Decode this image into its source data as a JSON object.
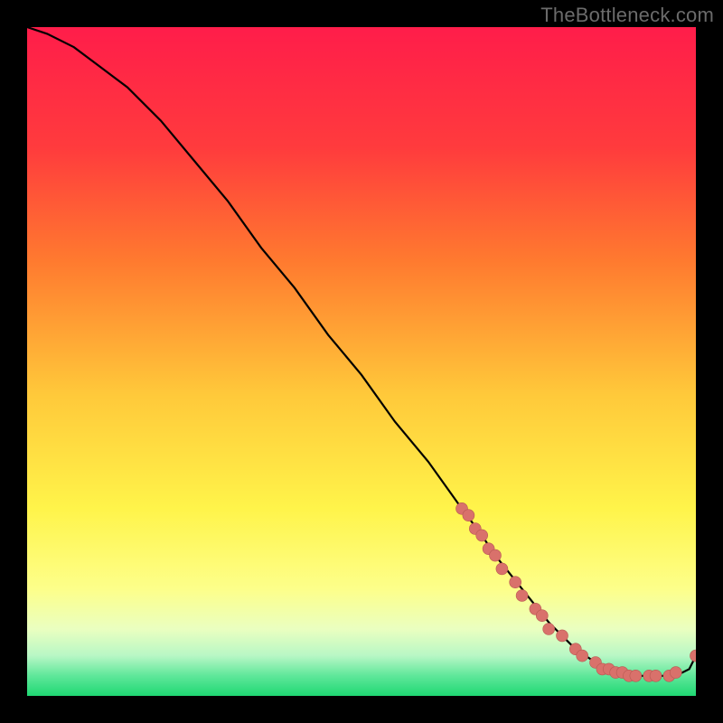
{
  "watermark": "TheBottleneck.com",
  "colors": {
    "gradient_top": "#ff1d4a",
    "gradient_mid1": "#ff6a2f",
    "gradient_mid2": "#ffd23a",
    "gradient_mid3": "#fff44a",
    "gradient_light": "#f7ffb3",
    "gradient_green1": "#a8f7c0",
    "gradient_green2": "#28e07a",
    "curve": "#000000",
    "point_fill": "#d9716b",
    "point_stroke": "#b85a53",
    "background": "#000000"
  },
  "chart_data": {
    "type": "line",
    "title": "",
    "xlabel": "",
    "ylabel": "",
    "xlim": [
      0,
      100
    ],
    "ylim": [
      0,
      100
    ],
    "grid": false,
    "legend": false,
    "series": [
      {
        "name": "bottleneck-curve",
        "x": [
          0,
          3,
          7,
          11,
          15,
          20,
          25,
          30,
          35,
          40,
          45,
          50,
          55,
          60,
          65,
          68,
          70,
          74,
          78,
          82,
          85,
          88,
          90,
          92,
          95,
          97,
          99,
          100
        ],
        "y": [
          100,
          99,
          97,
          94,
          91,
          86,
          80,
          74,
          67,
          61,
          54,
          48,
          41,
          35,
          28,
          24,
          21,
          16,
          11,
          7,
          5,
          4,
          3,
          3,
          3,
          3,
          4,
          6
        ]
      }
    ],
    "highlight_points": {
      "name": "highlight-dots",
      "color": "#d9716b",
      "points": [
        {
          "x": 65,
          "y": 28
        },
        {
          "x": 66,
          "y": 27
        },
        {
          "x": 67,
          "y": 25
        },
        {
          "x": 68,
          "y": 24
        },
        {
          "x": 69,
          "y": 22
        },
        {
          "x": 70,
          "y": 21
        },
        {
          "x": 71,
          "y": 19
        },
        {
          "x": 73,
          "y": 17
        },
        {
          "x": 74,
          "y": 15
        },
        {
          "x": 76,
          "y": 13
        },
        {
          "x": 77,
          "y": 12
        },
        {
          "x": 78,
          "y": 10
        },
        {
          "x": 80,
          "y": 9
        },
        {
          "x": 82,
          "y": 7
        },
        {
          "x": 83,
          "y": 6
        },
        {
          "x": 85,
          "y": 5
        },
        {
          "x": 86,
          "y": 4
        },
        {
          "x": 87,
          "y": 4
        },
        {
          "x": 88,
          "y": 3.5
        },
        {
          "x": 89,
          "y": 3.5
        },
        {
          "x": 90,
          "y": 3
        },
        {
          "x": 91,
          "y": 3
        },
        {
          "x": 93,
          "y": 3
        },
        {
          "x": 94,
          "y": 3
        },
        {
          "x": 96,
          "y": 3
        },
        {
          "x": 97,
          "y": 3.5
        },
        {
          "x": 100,
          "y": 6
        }
      ]
    }
  }
}
